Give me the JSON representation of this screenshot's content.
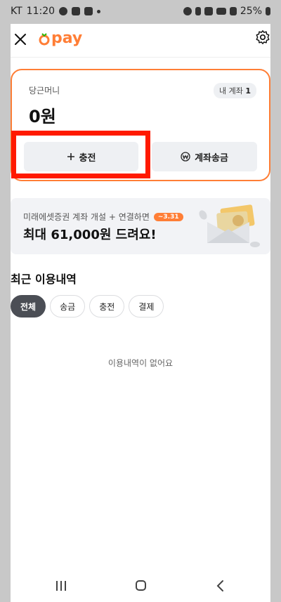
{
  "status_bar": {
    "carrier": "KT",
    "time": "11:20",
    "battery": "25%"
  },
  "header": {
    "logo_text": "pay",
    "close_icon": "close-icon",
    "settings_icon": "gear-icon"
  },
  "wallet": {
    "label": "당근머니",
    "account_badge_label": "내 계좌",
    "account_count": "1",
    "balance": "0원",
    "charge_button": "충전",
    "transfer_button": "계좌송금"
  },
  "banner": {
    "subtitle": "미래에셋증권 계좌 개설 + 연결하면",
    "dday": "~3.31",
    "title": "최대 61,000원 드려요!"
  },
  "history": {
    "title": "최근 이용내역",
    "filters": [
      {
        "label": "전체",
        "active": true
      },
      {
        "label": "송금",
        "active": false
      },
      {
        "label": "충전",
        "active": false
      },
      {
        "label": "결제",
        "active": false
      }
    ],
    "empty_text": "이용내역이 없어요"
  },
  "colors": {
    "brand": "#ff7e36",
    "highlight": "#ff1a00"
  }
}
